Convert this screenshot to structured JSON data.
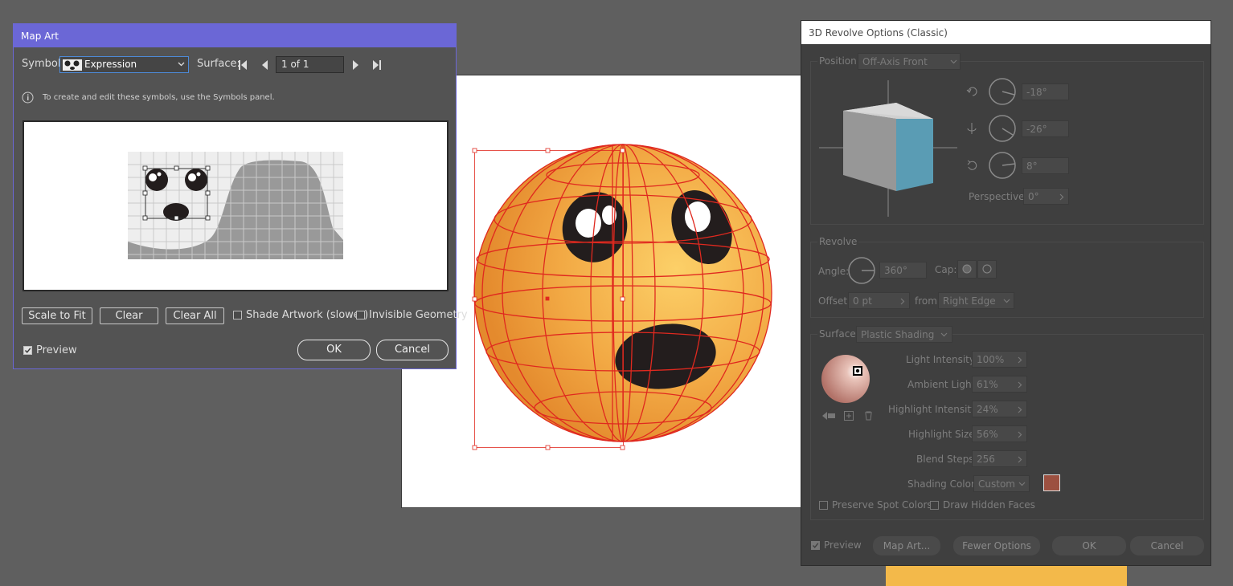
{
  "map_art": {
    "title": "Map Art",
    "symbol_label": "Symbol:",
    "symbol_value": "Expression",
    "surface_label": "Surface:",
    "surface_value": "1 of 1",
    "info_text": "To create and edit these symbols, use the Symbols panel.",
    "scale_to_fit": "Scale to Fit",
    "clear": "Clear",
    "clear_all": "Clear All",
    "shade_artwork": "Shade Artwork (slower)",
    "invisible_geometry": "Invisible Geometry",
    "preview": "Preview",
    "ok": "OK",
    "cancel": "Cancel"
  },
  "revolve": {
    "title": "3D Revolve Options (Classic)",
    "position_label": "Position:",
    "position_value": "Off-Axis Front",
    "rot_x": "-18°",
    "rot_y": "-26°",
    "rot_z": "8°",
    "perspective_label": "Perspective:",
    "perspective_value": "0°",
    "revolve_header": "Revolve",
    "angle_label": "Angle:",
    "angle_value": "360°",
    "cap_label": "Cap:",
    "offset_label": "Offset:",
    "offset_value": "0 pt",
    "from_label": "from",
    "from_value": "Right Edge",
    "surface_label": "Surface:",
    "surface_value": "Plastic Shading",
    "light_intensity_label": "Light Intensity:",
    "light_intensity_value": "100%",
    "ambient_light_label": "Ambient Light:",
    "ambient_light_value": "61%",
    "highlight_intensity_label": "Highlight Intensity:",
    "highlight_intensity_value": "24%",
    "highlight_size_label": "Highlight Size:",
    "highlight_size_value": "56%",
    "blend_steps_label": "Blend Steps:",
    "blend_steps_value": "256",
    "shading_color_label": "Shading Color:",
    "shading_color_value": "Custom",
    "shading_color_swatch": "#9c5040",
    "preserve_spot": "Preserve Spot Colors",
    "draw_hidden": "Draw Hidden Faces",
    "preview": "Preview",
    "map_art_button": "Map Art...",
    "fewer_options": "Fewer Options",
    "ok": "OK",
    "cancel": "Cancel"
  },
  "colors": {
    "accent": "#6b67d6",
    "sphere": "#f1a540",
    "wire": "#e0291f"
  }
}
